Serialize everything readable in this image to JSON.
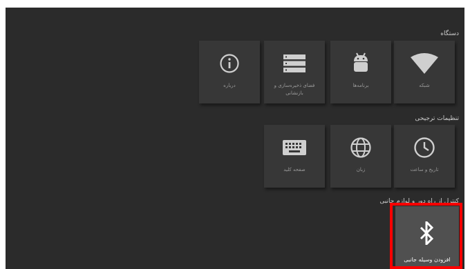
{
  "sections": {
    "device": {
      "title": "دستگاه",
      "tiles": [
        {
          "label": "شبکه",
          "icon": "wifi-icon"
        },
        {
          "label": "برنامه‌ها",
          "icon": "android-icon"
        },
        {
          "label": "فضای ذخیره‌سازی و بازنشانی",
          "icon": "storage-icon"
        },
        {
          "label": "درباره",
          "icon": "info-icon"
        }
      ]
    },
    "preferences": {
      "title": "تنظیمات ترجیحی",
      "tiles": [
        {
          "label": "تاریخ و ساعت",
          "icon": "clock-icon"
        },
        {
          "label": "زبان",
          "icon": "globe-icon"
        },
        {
          "label": "صفحه کلید",
          "icon": "keyboard-icon"
        }
      ]
    },
    "remotes": {
      "title": "کنترل از راه دور و لوازم جانبی",
      "tiles": [
        {
          "label": "افزودن وسیله جانبی",
          "icon": "bluetooth-icon"
        }
      ]
    }
  },
  "highlight_color": "#ff0000"
}
